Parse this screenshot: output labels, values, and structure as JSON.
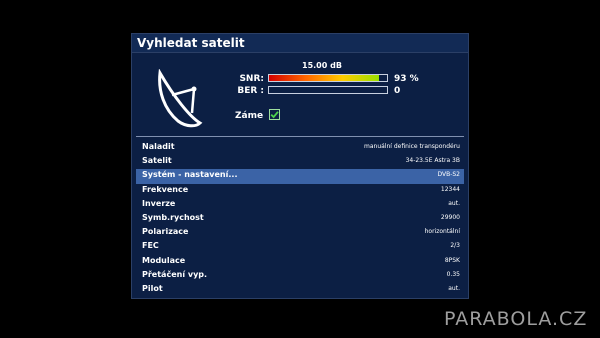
{
  "window": {
    "title": "Vyhledat satelit"
  },
  "signal": {
    "level_text": "15.00 dB",
    "snr_label": "SNR:",
    "snr_value": "93 %",
    "snr_fill": 0.93,
    "ber_label": "BER :",
    "ber_value": "0",
    "ber_fill": 0
  },
  "lock": {
    "label": "Záme",
    "checked": true
  },
  "settings": [
    {
      "label": "Naladit",
      "value": "manuální definice transpondéru"
    },
    {
      "label": "Satelit",
      "value": "34-23.5E Astra 3B"
    },
    {
      "label": "Systém - nastavení...",
      "value": "DVB-S2",
      "selected": true
    },
    {
      "label": "Frekvence",
      "value": "12344"
    },
    {
      "label": "Inverze",
      "value": "aut."
    },
    {
      "label": "Symb.rychost",
      "value": "29900"
    },
    {
      "label": "Polarizace",
      "value": "horizontální"
    },
    {
      "label": "FEC",
      "value": "2/3"
    },
    {
      "label": "Modulace",
      "value": "8PSK"
    },
    {
      "label": "Přetáčení vyp.",
      "value": "0.35"
    },
    {
      "label": "Pilot",
      "value": "aut."
    }
  ],
  "watermark": "PARABOLA.CZ",
  "colors": {
    "panel": "#0c1f44",
    "selected_row": "#3b63a6",
    "check": "#4cd14c"
  },
  "icons": {
    "dish": "satellite-dish-icon",
    "check": "checkmark-icon"
  }
}
